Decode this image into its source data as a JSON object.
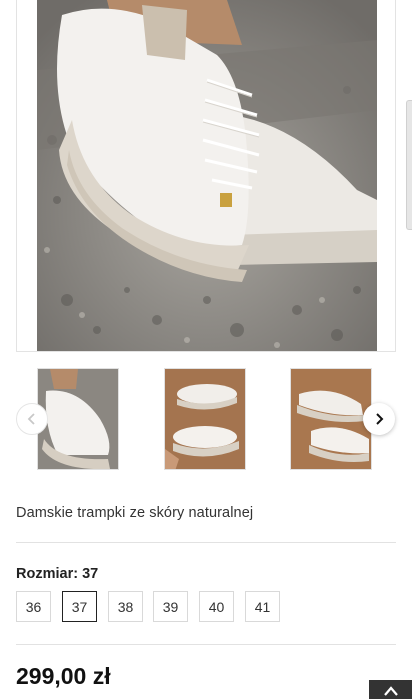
{
  "product": {
    "title": "Damskie trampki ze skóry naturalnej",
    "size_label": "Rozmiar: 37",
    "sizes": [
      "36",
      "37",
      "38",
      "39",
      "40",
      "41"
    ],
    "selected_size": "37",
    "price": "299,00 zł"
  },
  "gallery": {
    "thumbnail_count": 3,
    "prev_icon": "chevron-left-icon",
    "next_icon": "chevron-right-icon"
  },
  "scroll_top_icon": "chevron-up-icon"
}
